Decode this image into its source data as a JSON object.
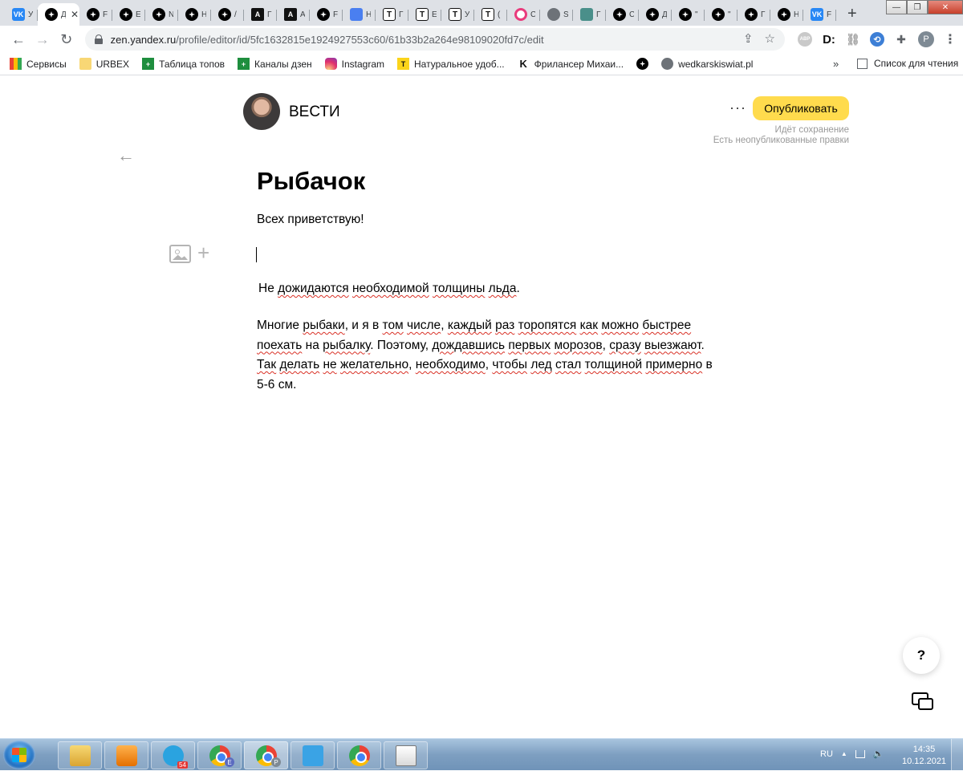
{
  "browser": {
    "tabs": [
      {
        "icon": "vk",
        "glyph": "VK",
        "label": "У",
        "active": false
      },
      {
        "icon": "zen",
        "glyph": "",
        "label": "Д",
        "active": true
      },
      {
        "icon": "zen",
        "glyph": "",
        "label": "F",
        "active": false
      },
      {
        "icon": "zen",
        "glyph": "",
        "label": "Е",
        "active": false
      },
      {
        "icon": "zen",
        "glyph": "",
        "label": "N",
        "active": false
      },
      {
        "icon": "zen",
        "glyph": "",
        "label": "Н",
        "active": false
      },
      {
        "icon": "zen",
        "glyph": "",
        "label": "/",
        "active": false
      },
      {
        "icon": "a",
        "glyph": "A",
        "label": "Г",
        "active": false
      },
      {
        "icon": "a",
        "glyph": "A",
        "label": "A",
        "active": false
      },
      {
        "icon": "zen",
        "glyph": "",
        "label": "F",
        "active": false
      },
      {
        "icon": "doc",
        "glyph": "",
        "label": "Н",
        "active": false
      },
      {
        "icon": "t",
        "glyph": "T",
        "label": "Г",
        "active": false
      },
      {
        "icon": "t",
        "glyph": "T",
        "label": "Е",
        "active": false
      },
      {
        "icon": "t",
        "glyph": "T",
        "label": "У",
        "active": false
      },
      {
        "icon": "t",
        "glyph": "T",
        "label": "(",
        "active": false
      },
      {
        "icon": "pink",
        "glyph": "",
        "label": "С",
        "active": false
      },
      {
        "icon": "globe",
        "glyph": "",
        "label": "S",
        "active": false
      },
      {
        "icon": "star",
        "glyph": "",
        "label": "Г",
        "active": false
      },
      {
        "icon": "zen",
        "glyph": "",
        "label": "С",
        "active": false
      },
      {
        "icon": "zen",
        "glyph": "",
        "label": "Д",
        "active": false
      },
      {
        "icon": "zen",
        "glyph": "",
        "label": "\"",
        "active": false
      },
      {
        "icon": "zen",
        "glyph": "",
        "label": "\"",
        "active": false
      },
      {
        "icon": "zen",
        "glyph": "",
        "label": "Г",
        "active": false
      },
      {
        "icon": "zen",
        "glyph": "",
        "label": "Н",
        "active": false
      },
      {
        "icon": "vk",
        "glyph": "VK",
        "label": "F",
        "active": false
      }
    ],
    "close_glyph": "✕",
    "newtab_glyph": "+",
    "window": {
      "minimize": "—",
      "restore": "❐",
      "close": "✕"
    },
    "nav": {
      "back": "←",
      "forward": "→",
      "reload": "↻"
    },
    "url_host": "zen.yandex.ru",
    "url_path": "/profile/editor/id/5fc1632815e1924927553c60/61b33b2a264e98109020fd7c/edit",
    "omni_icons": {
      "share": "⇪",
      "bookmark": "☆"
    },
    "extensions": {
      "abp": "ABP",
      "d": "D:",
      "link": "⛓",
      "share": "⟲",
      "puzzle": "✚",
      "profile": "Р",
      "menu": "⋮"
    },
    "bookmarks": [
      {
        "icon": "grid",
        "glyph": "",
        "label": "Сервисы"
      },
      {
        "icon": "folder",
        "glyph": "",
        "label": "URBEX"
      },
      {
        "icon": "sheet",
        "glyph": "+",
        "label": "Таблица топов"
      },
      {
        "icon": "sheet",
        "glyph": "+",
        "label": "Каналы дзен"
      },
      {
        "icon": "insta",
        "glyph": "",
        "label": "Instagram"
      },
      {
        "icon": "tyellow",
        "glyph": "T",
        "label": "Натуральное удоб..."
      },
      {
        "icon": "k",
        "glyph": "K",
        "label": "Фрилансер Михаи..."
      },
      {
        "icon": "zen",
        "glyph": "",
        "label": ""
      },
      {
        "icon": "globe",
        "glyph": "",
        "label": "wedkarskiswiat.pl"
      }
    ],
    "bookmarks_more": "»",
    "reading_list": "Список для чтения"
  },
  "editor": {
    "channel_name": "ВЕСТИ",
    "more_menu": "···",
    "publish_label": "Опубликовать",
    "status_line1": "Идёт сохранение",
    "status_line2": "Есть неопубликованные правки",
    "back_glyph": "←",
    "plus_glyph": "+",
    "title": "Рыбачок",
    "greeting": "Всех приветствую!",
    "subheading": [
      {
        "t": "Не ",
        "sp": false
      },
      {
        "t": "дожидаются",
        "sp": true
      },
      {
        "t": " ",
        "sp": false
      },
      {
        "t": "необходимой",
        "sp": true
      },
      {
        "t": " ",
        "sp": false
      },
      {
        "t": "толщины",
        "sp": true
      },
      {
        "t": " ",
        "sp": false
      },
      {
        "t": "льда",
        "sp": true
      },
      {
        "t": ".",
        "sp": false
      }
    ],
    "body": [
      {
        "t": "Многие ",
        "sp": false
      },
      {
        "t": "рыбаки",
        "sp": true
      },
      {
        "t": ", и я в ",
        "sp": false
      },
      {
        "t": "том",
        "sp": true
      },
      {
        "t": " ",
        "sp": false
      },
      {
        "t": "числе",
        "sp": true
      },
      {
        "t": ", ",
        "sp": false
      },
      {
        "t": "каждый",
        "sp": true
      },
      {
        "t": " ",
        "sp": false
      },
      {
        "t": "раз",
        "sp": true
      },
      {
        "t": " ",
        "sp": false
      },
      {
        "t": "торопятся",
        "sp": true
      },
      {
        "t": " ",
        "sp": false
      },
      {
        "t": "как",
        "sp": true
      },
      {
        "t": " ",
        "sp": false
      },
      {
        "t": "можно",
        "sp": true
      },
      {
        "t": " ",
        "sp": false
      },
      {
        "t": "быстрее",
        "sp": true
      },
      {
        "t": " ",
        "sp": false
      },
      {
        "t": "поехать",
        "sp": true
      },
      {
        "t": " на ",
        "sp": false
      },
      {
        "t": "рыбалку",
        "sp": true
      },
      {
        "t": ". Поэтому, ",
        "sp": false
      },
      {
        "t": "дождавшись",
        "sp": true
      },
      {
        "t": " ",
        "sp": false
      },
      {
        "t": "первых",
        "sp": true
      },
      {
        "t": " ",
        "sp": false
      },
      {
        "t": "морозов",
        "sp": true
      },
      {
        "t": ", ",
        "sp": false
      },
      {
        "t": "сразу",
        "sp": true
      },
      {
        "t": " ",
        "sp": false
      },
      {
        "t": "выезжают",
        "sp": true
      },
      {
        "t": ". ",
        "sp": false
      },
      {
        "t": "Так",
        "sp": true
      },
      {
        "t": " ",
        "sp": false
      },
      {
        "t": "делать",
        "sp": true
      },
      {
        "t": " ",
        "sp": false
      },
      {
        "t": "не",
        "sp": true
      },
      {
        "t": " ",
        "sp": false
      },
      {
        "t": "желательно",
        "sp": true
      },
      {
        "t": ", ",
        "sp": false
      },
      {
        "t": "необходимо",
        "sp": true
      },
      {
        "t": ", ",
        "sp": false
      },
      {
        "t": "чтобы",
        "sp": true
      },
      {
        "t": " ",
        "sp": false
      },
      {
        "t": "лед",
        "sp": true
      },
      {
        "t": " ",
        "sp": false
      },
      {
        "t": "стал",
        "sp": true
      },
      {
        "t": " ",
        "sp": false
      },
      {
        "t": "толщиной",
        "sp": true
      },
      {
        "t": " ",
        "sp": false
      },
      {
        "t": "примерно",
        "sp": true
      },
      {
        "t": " в 5-6 см.",
        "sp": false
      }
    ],
    "help_label": "?"
  },
  "taskbar": {
    "apps": [
      {
        "name": "explorer",
        "badge": "",
        "sub": "",
        "active": false
      },
      {
        "name": "media",
        "badge": "",
        "sub": "",
        "active": false
      },
      {
        "name": "tg",
        "badge": "54",
        "sub": "",
        "active": false
      },
      {
        "name": "chrome",
        "badge": "",
        "sub": "Е",
        "active": false
      },
      {
        "name": "chrome",
        "badge": "",
        "sub": "Р",
        "active": true
      },
      {
        "name": "zen",
        "badge": "",
        "sub": "",
        "active": false
      },
      {
        "name": "chrome",
        "badge": "",
        "sub": "",
        "active": false
      },
      {
        "name": "sheet",
        "badge": "",
        "sub": "",
        "active": false
      }
    ],
    "lang": "RU",
    "tray_arrow": "▲",
    "volume": "🔈",
    "time": "14:35",
    "date": "10.12.2021"
  },
  "colors": {
    "publish": "#ffdb4d",
    "spellcheck": "#d93025"
  }
}
